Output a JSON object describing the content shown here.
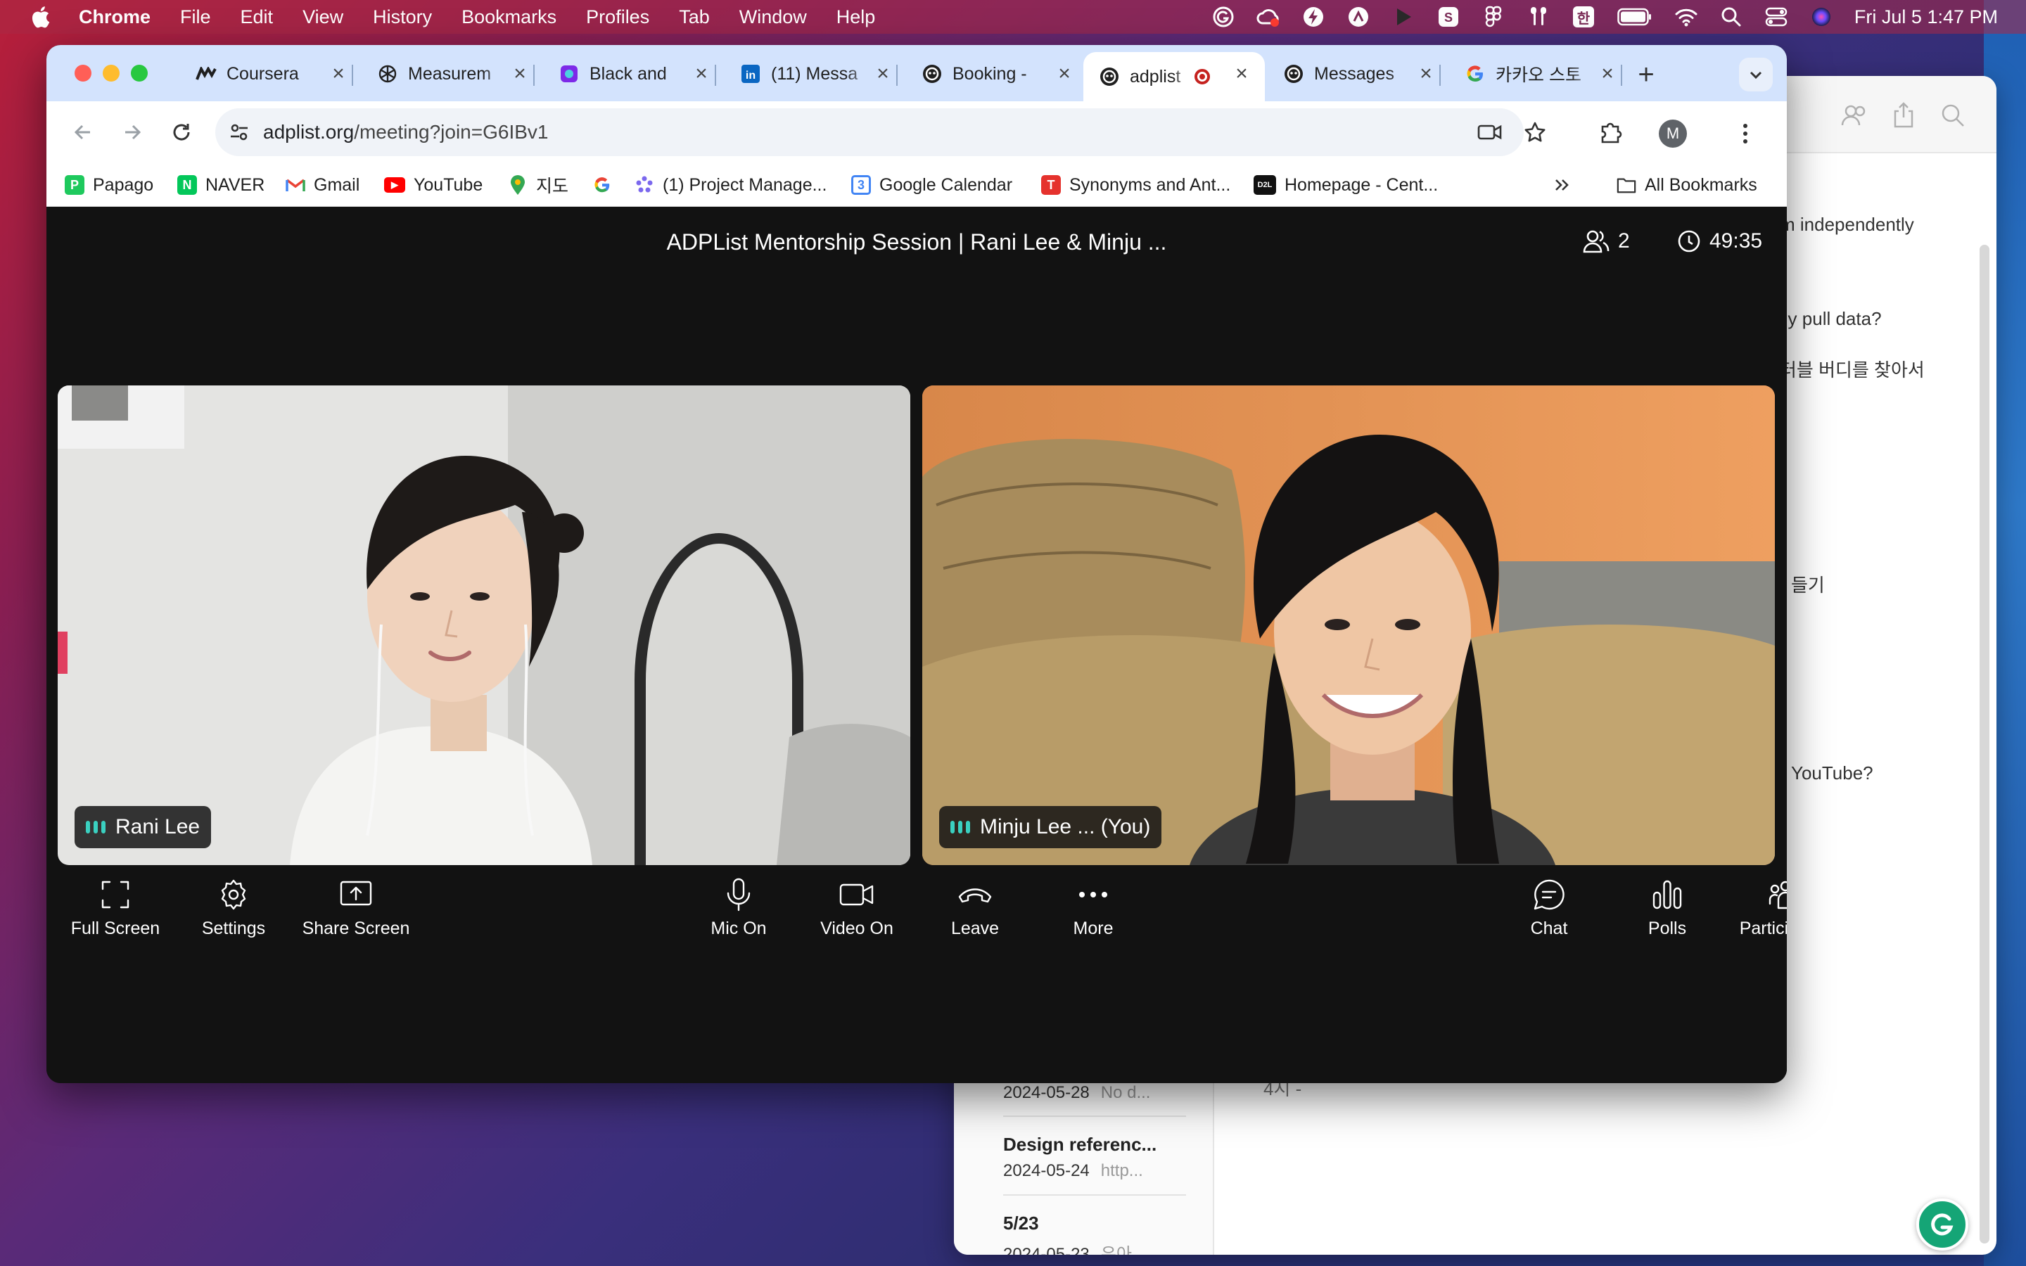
{
  "menubar": {
    "app_name": "Chrome",
    "menus": [
      "File",
      "Edit",
      "View",
      "History",
      "Bookmarks",
      "Profiles",
      "Tab",
      "Window",
      "Help"
    ],
    "status_badge_text": "한",
    "datetime": "Fri Jul 5  1:47 PM"
  },
  "tabs": [
    {
      "title": "Coursera",
      "favicon": "coursera-icon",
      "color": "#1f1f1f"
    },
    {
      "title": "Measurem",
      "favicon": "openai-icon",
      "color": "#1f1f1f"
    },
    {
      "title": "Black and",
      "favicon": "canva-icon",
      "color": "#7d2ae8"
    },
    {
      "title": "(11) Messa",
      "favicon": "linkedin-icon",
      "color": "#0a66c2"
    },
    {
      "title": "Booking -",
      "favicon": "adplist-icon",
      "color": "#1f1f1f"
    },
    {
      "title": "adplist",
      "favicon": "adplist-icon",
      "color": "#1f1f1f",
      "active": true,
      "recording": true
    },
    {
      "title": "Messages",
      "favicon": "adplist-icon",
      "color": "#1f1f1f"
    },
    {
      "title": "카카오 스토",
      "favicon": "google-icon",
      "color": "#4285f4"
    }
  ],
  "omnibox": {
    "domain": "adplist.org",
    "path": "/meeting?join=G6IBv1"
  },
  "avatar_initial": "M",
  "bookmarks": {
    "items": [
      {
        "label": "Papago",
        "icon": "papago-icon",
        "bg": "#1ec95d",
        "glyph": "P"
      },
      {
        "label": "NAVER",
        "icon": "naver-icon",
        "bg": "#03c75a",
        "glyph": "N"
      },
      {
        "label": "Gmail",
        "icon": "gmail-icon",
        "bg": "#ffffff",
        "glyph": "M"
      },
      {
        "label": "YouTube",
        "icon": "youtube-icon",
        "bg": "#ff0000",
        "glyph": "▶"
      },
      {
        "label": "지도",
        "icon": "map-pin-icon",
        "bg": "#ffffff",
        "glyph": ""
      },
      {
        "label": "",
        "icon": "google-icon",
        "bg": "#ffffff",
        "glyph": "G"
      },
      {
        "label": "(1) Project Manage...",
        "icon": "clickup-icon",
        "bg": "#ffffff",
        "glyph": "✲"
      },
      {
        "label": "Google Calendar",
        "icon": "calendar-icon",
        "bg": "#4285f4",
        "glyph": "3"
      },
      {
        "label": "Synonyms and Ant...",
        "icon": "thesaurus-icon",
        "bg": "#e5322d",
        "glyph": "T"
      },
      {
        "label": "Homepage - Cent...",
        "icon": "d2l-icon",
        "bg": "#111111",
        "glyph": "D2L"
      }
    ],
    "all_bookmarks_label": "All Bookmarks"
  },
  "meeting": {
    "title": "ADPList Mentorship Session | Rani Lee & Minju ...",
    "participant_count": "2",
    "timer": "49:35",
    "tiles": [
      {
        "name": "Rani Lee"
      },
      {
        "name": "Minju Lee ... (You)"
      }
    ]
  },
  "controls": {
    "left": [
      {
        "label": "Full Screen",
        "icon": "fullscreen-icon"
      },
      {
        "label": "Settings",
        "icon": "settings-icon"
      },
      {
        "label": "Share Screen",
        "icon": "share-screen-icon"
      }
    ],
    "center": [
      {
        "label": "Mic On",
        "icon": "mic-icon"
      },
      {
        "label": "Video On",
        "icon": "video-icon"
      },
      {
        "label": "Leave",
        "icon": "leave-phone-icon"
      },
      {
        "label": "More",
        "icon": "more-icon"
      }
    ],
    "right": [
      {
        "label": "Chat",
        "icon": "chat-icon"
      },
      {
        "label": "Polls",
        "icon": "polls-icon"
      },
      {
        "label": "Participants",
        "icon": "participants-icon"
      }
    ]
  },
  "notes_window": {
    "visible_lines": [
      "m independently",
      "ily pull data?",
      "터블 버디를 찾아서",
      "들기",
      "YouTube?"
    ],
    "list_items": [
      {
        "title": "",
        "date": "2024-05-28",
        "preview": "No d..."
      },
      {
        "title": "Design referenc...",
        "date": "2024-05-24",
        "preview": "http..."
      },
      {
        "title": "5/23",
        "date": "2024-05-23",
        "preview": "유아..."
      }
    ],
    "partial_body_text": "4시 -"
  }
}
